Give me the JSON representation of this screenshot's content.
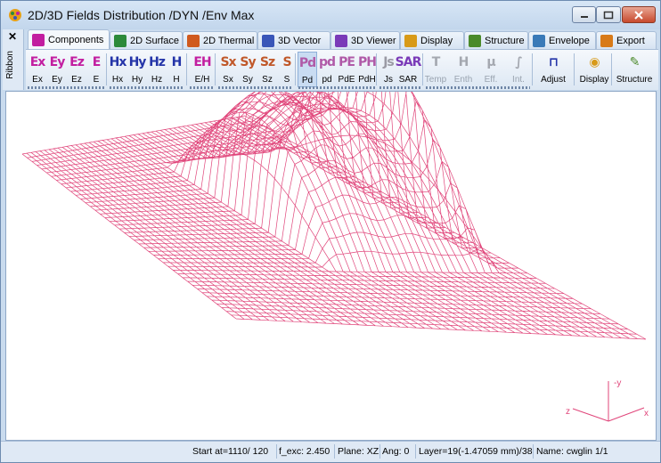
{
  "window": {
    "title": "2D/3D Fields Distribution /DYN /Env Max"
  },
  "ribbon": {
    "close_label": "✕",
    "side_label": "Ribbon"
  },
  "tabs": [
    {
      "label": "Components",
      "icon": "letter-e-icon",
      "color": "#c21ea0"
    },
    {
      "label": "2D Surface",
      "icon": "surface-icon",
      "color": "#2c8a3a"
    },
    {
      "label": "2D Thermal",
      "icon": "thermal-icon",
      "color": "#d05a1e"
    },
    {
      "label": "3D Vector",
      "icon": "vector-icon",
      "color": "#3a56b8"
    },
    {
      "label": "3D Viewer",
      "icon": "viewer-icon",
      "color": "#7a3ab8"
    },
    {
      "label": "Display",
      "icon": "display-icon",
      "color": "#d89a18"
    },
    {
      "label": "Structure",
      "icon": "structure-icon",
      "color": "#4b8a2a"
    },
    {
      "label": "Envelope",
      "icon": "envelope-icon",
      "color": "#3a7ab8"
    },
    {
      "label": "Export",
      "icon": "export-icon",
      "color": "#d87a18"
    }
  ],
  "toolbar": {
    "buttons": [
      {
        "icon_text": "Ex",
        "label": "Ex",
        "color": "#c21ea0"
      },
      {
        "icon_text": "Ey",
        "label": "Ey",
        "color": "#c21ea0"
      },
      {
        "icon_text": "Ez",
        "label": "Ez",
        "color": "#c21ea0"
      },
      {
        "icon_text": "E",
        "label": "E",
        "color": "#c21ea0"
      },
      {
        "icon_text": "Hx",
        "label": "Hx",
        "color": "#2434a8"
      },
      {
        "icon_text": "Hy",
        "label": "Hy",
        "color": "#2434a8"
      },
      {
        "icon_text": "Hz",
        "label": "Hz",
        "color": "#2434a8"
      },
      {
        "icon_text": "H",
        "label": "H",
        "color": "#2434a8"
      },
      {
        "icon_text": "EH",
        "label": "E/H",
        "color": "#c21ea0"
      },
      {
        "icon_text": "Sx",
        "label": "Sx",
        "color": "#c0582a"
      },
      {
        "icon_text": "Sy",
        "label": "Sy",
        "color": "#c0582a"
      },
      {
        "icon_text": "Sz",
        "label": "Sz",
        "color": "#c0582a"
      },
      {
        "icon_text": "S",
        "label": "S",
        "color": "#c0582a"
      },
      {
        "icon_text": "Pd",
        "label": "Pd",
        "color": "#b05aa8"
      },
      {
        "icon_text": "pd",
        "label": "pd",
        "color": "#b05aa8"
      },
      {
        "icon_text": "PE",
        "label": "PdE",
        "color": "#b05aa8"
      },
      {
        "icon_text": "PH",
        "label": "PdH",
        "color": "#b05aa8"
      },
      {
        "icon_text": "Js",
        "label": "Js",
        "color": "#9a9aa4"
      },
      {
        "icon_text": "SAR",
        "label": "SAR",
        "color": "#7a3ab8"
      },
      {
        "icon_text": "T",
        "label": "Temp",
        "color": "#a4a8b0"
      },
      {
        "icon_text": "H",
        "label": "Enth",
        "color": "#a4a8b0"
      },
      {
        "icon_text": "μ",
        "label": "Eff.",
        "color": "#a4a8b0"
      },
      {
        "icon_text": "∫",
        "label": "Int.",
        "color": "#a4a8b0"
      },
      {
        "icon_text": "⊓",
        "label": "Adjust",
        "color": "#2434a8"
      },
      {
        "icon_text": "◉",
        "label": "Display",
        "color": "#d89a18"
      },
      {
        "icon_text": "✎",
        "label": "Structure",
        "color": "#4b8a2a"
      }
    ]
  },
  "axes_labels": {
    "y": "-y",
    "z": "z",
    "x": "x"
  },
  "colors": {
    "mesh": "#e0457a",
    "axes": "#e0457a"
  },
  "status": {
    "start_at": "Start at=1110/ 120",
    "f_exc": "f_exc:  2.450",
    "plane": "Plane: XZ",
    "ang": "Ang:    0",
    "layer": "Layer=19(-1.47059 mm)/38",
    "name": "Name: cwglin 1/1"
  }
}
